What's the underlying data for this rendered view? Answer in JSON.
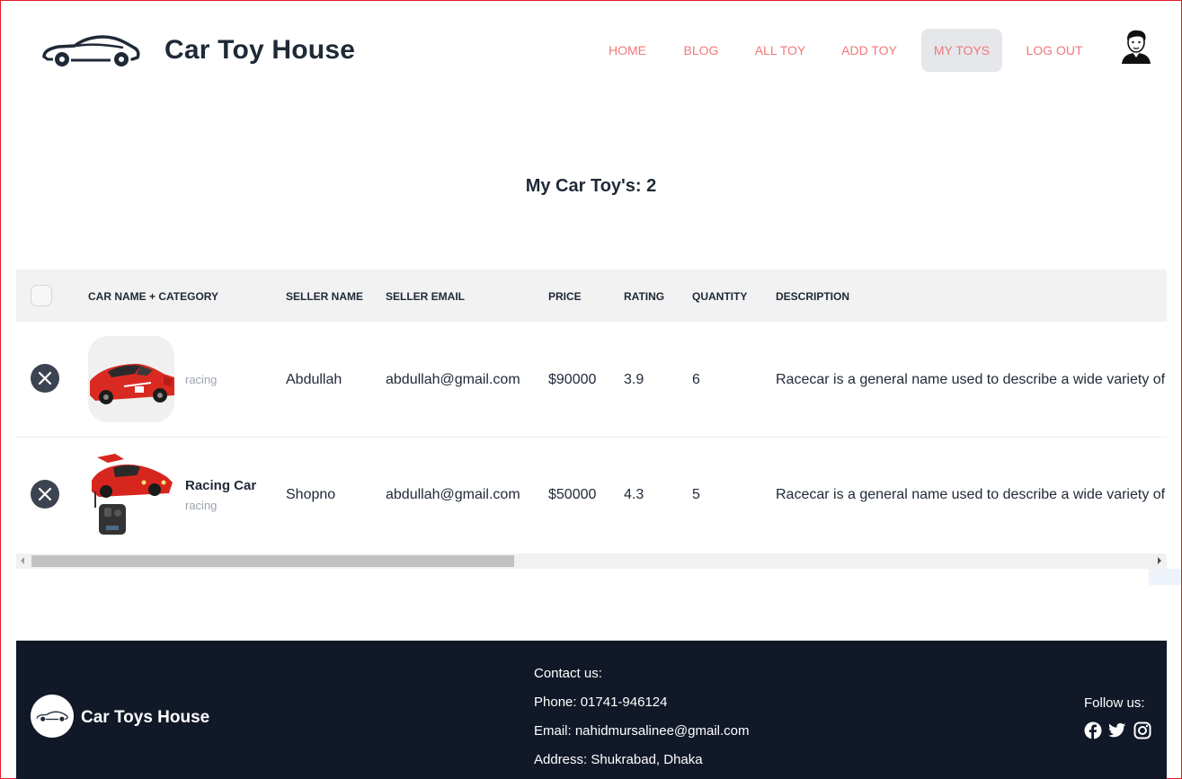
{
  "header": {
    "brand": "Car Toy House",
    "nav": [
      {
        "label": "HOME",
        "active": false
      },
      {
        "label": "BLOG",
        "active": false
      },
      {
        "label": "ALL TOY",
        "active": false
      },
      {
        "label": "ADD TOY",
        "active": false
      },
      {
        "label": "MY TOYS",
        "active": true
      },
      {
        "label": "LOG OUT",
        "active": false
      }
    ],
    "avatar_icon": "user-avatar-icon"
  },
  "page": {
    "title": "My Car Toy's: 2"
  },
  "table": {
    "columns": [
      "CAR NAME + CATEGORY",
      "SELLER NAME",
      "SELLER EMAIL",
      "PRICE",
      "RATING",
      "QUANTITY",
      "DESCRIPTION"
    ],
    "rows": [
      {
        "name": "",
        "category": "racing",
        "seller": "Abdullah",
        "email": "abdullah@gmail.com",
        "price": "$90000",
        "rating": "3.9",
        "quantity": "6",
        "description": "Racecar is a general name used to describe a wide variety of m"
      },
      {
        "name": "Racing Car",
        "category": "racing",
        "seller": "Shopno",
        "email": "abdullah@gmail.com",
        "price": "$50000",
        "rating": "4.3",
        "quantity": "5",
        "description": "Racecar is a general name used to describe a wide variety of m"
      }
    ]
  },
  "footer": {
    "brand": "Car Toys House",
    "contact_title": "Contact us:",
    "phone": "Phone: 01741-946124",
    "email": "Email: nahidmursalinee@gmail.com",
    "address": "Address: Shukrabad, Dhaka",
    "follow": "Follow us:",
    "social_icons": [
      "facebook-icon",
      "twitter-icon",
      "instagram-icon"
    ]
  },
  "colors": {
    "nav_link": "#f0787a",
    "footer_bg": "#111827",
    "delete_button": "#3d4451"
  }
}
